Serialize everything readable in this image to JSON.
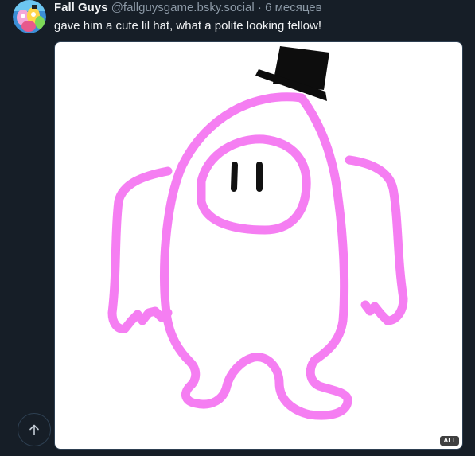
{
  "post": {
    "author_name": "Fall Guys",
    "author_handle": "@fallguysgame.bsky.social",
    "separator": "·",
    "timestamp": "6 месяцев",
    "text": "gave him a cute lil hat, what a polite looking fellow!",
    "media": {
      "alt_badge": "ALT",
      "description_icon": "fall-guys-bean-drawing"
    }
  },
  "controls": {
    "scroll_top_icon": "arrow-up-icon"
  },
  "colors": {
    "background": "#161e27",
    "text_primary": "#f1f3f5",
    "text_secondary": "#8b98a5",
    "drawing_outline": "#f57ef2",
    "border": "#2e4052"
  }
}
